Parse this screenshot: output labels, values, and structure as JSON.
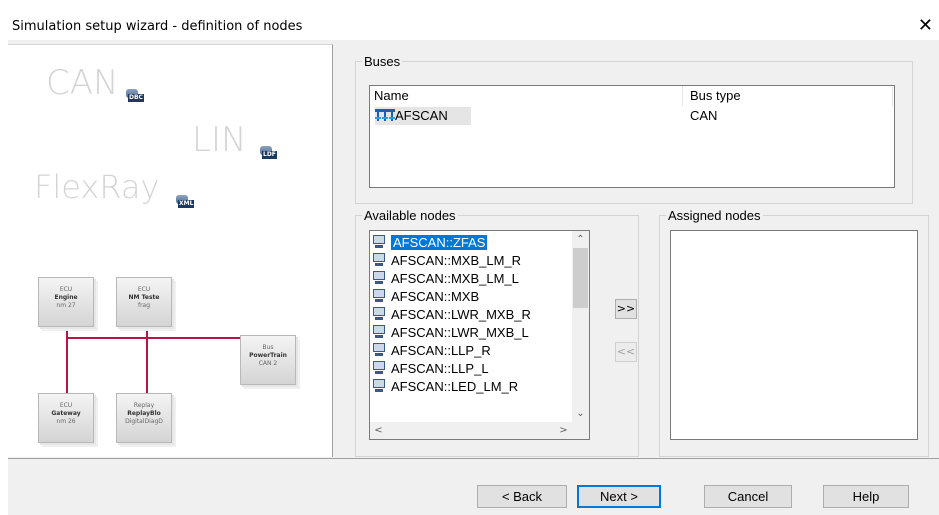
{
  "window": {
    "title": "Simulation setup wizard - definition of nodes"
  },
  "illustration": {
    "labels": [
      "CAN",
      "LIN",
      "FlexRay"
    ],
    "badges": [
      "DBC",
      "LDF",
      "XML"
    ],
    "ecus": [
      {
        "type": "ECU",
        "name": "Engine",
        "sub": "nm 27"
      },
      {
        "type": "ECU",
        "name": "NM Teste",
        "sub": "frag"
      },
      {
        "type": "Bus",
        "name": "PowerTrain",
        "sub": "CAN 2"
      },
      {
        "type": "ECU",
        "name": "Gateway",
        "sub": "nm 26"
      },
      {
        "type": "Replay",
        "name": "ReplayBlo",
        "sub": "DigitalDiagD"
      }
    ]
  },
  "buses": {
    "legend": "Buses",
    "columns": [
      "Name",
      "Bus type"
    ],
    "rows": [
      {
        "name": "AFSCAN",
        "type": "CAN"
      }
    ]
  },
  "available": {
    "legend": "Available nodes",
    "items": [
      "AFSCAN::ZFAS",
      "AFSCAN::MXB_LM_R",
      "AFSCAN::MXB_LM_L",
      "AFSCAN::MXB",
      "AFSCAN::LWR_MXB_R",
      "AFSCAN::LWR_MXB_L",
      "AFSCAN::LLP_R",
      "AFSCAN::LLP_L",
      "AFSCAN::LED_LM_R"
    ],
    "selected_index": 0
  },
  "assigned": {
    "legend": "Assigned nodes",
    "items": []
  },
  "move": {
    "add_label": ">>",
    "remove_label": "<<"
  },
  "buttons": {
    "back": "< Back",
    "next": "Next >",
    "cancel": "Cancel",
    "help": "Help"
  },
  "colors": {
    "selection": "#0078d7",
    "wire": "#b01946"
  }
}
